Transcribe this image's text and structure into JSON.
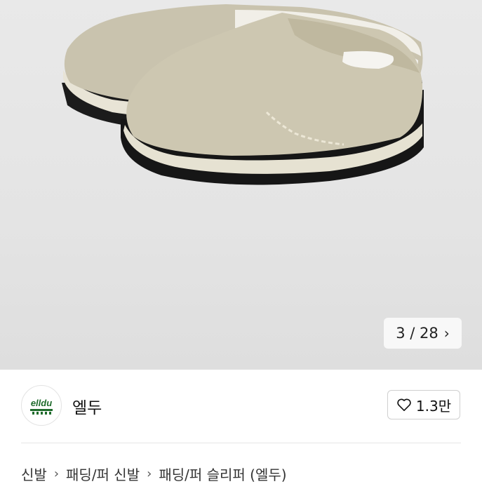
{
  "gallery": {
    "image_alt": "beige suede mule slippers",
    "counter": {
      "current": "3",
      "separator": "/",
      "total": "28"
    }
  },
  "seller": {
    "logo_text": "elldu",
    "name": "엘두",
    "likes": "1.3만"
  },
  "breadcrumb": [
    "신발",
    "패딩/퍼 신발",
    "패딩/퍼 슬리퍼 (엘두)"
  ],
  "colors": {
    "gallery_bg": "#e6e6e6",
    "logo_green": "#1f6b2c",
    "text": "#111111"
  }
}
